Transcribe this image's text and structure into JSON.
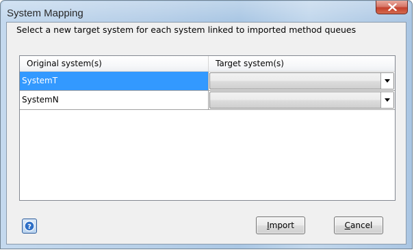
{
  "window": {
    "title": "System Mapping",
    "close_icon": "close-x-icon"
  },
  "dialog": {
    "instruction": "Select a new target system for each system linked to imported method queues"
  },
  "grid": {
    "columns": [
      "Original system(s)",
      "Target system(s)"
    ],
    "rows": [
      {
        "original": "SystemT",
        "target": "",
        "selected": true
      },
      {
        "original": "SystemN",
        "target": "",
        "selected": false
      }
    ]
  },
  "buttons": {
    "help_icon": "help-question-icon",
    "import_mnemonic": "I",
    "import_rest": "mport",
    "cancel_mnemonic": "C",
    "cancel_rest": "ancel"
  },
  "colors": {
    "selection": "#3399ff",
    "close_button": "#c4412d"
  }
}
